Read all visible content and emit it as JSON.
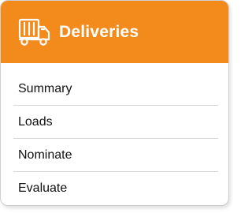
{
  "card": {
    "title": "Deliveries",
    "icon": "delivery-truck-icon",
    "header_color": "#f28b1c"
  },
  "menu": {
    "items": [
      {
        "label": "Summary"
      },
      {
        "label": "Loads"
      },
      {
        "label": "Nominate"
      },
      {
        "label": "Evaluate"
      }
    ]
  }
}
